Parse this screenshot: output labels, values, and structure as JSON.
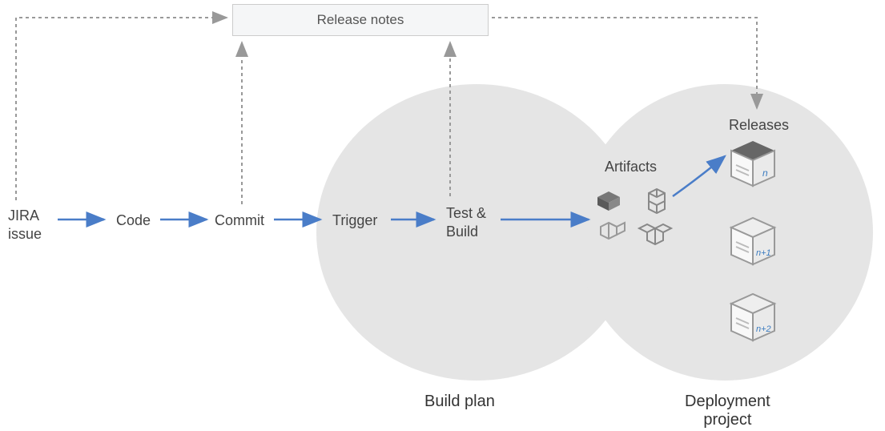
{
  "release_notes": "Release notes",
  "pipeline": {
    "jira": "JIRA\nissue",
    "code": "Code",
    "commit": "Commit",
    "trigger": "Trigger",
    "test_build": "Test &\nBuild",
    "artifacts": "Artifacts",
    "releases": "Releases"
  },
  "sections": {
    "build_plan": "Build plan",
    "deployment_project": "Deployment\nproject"
  },
  "release_boxes": [
    "n",
    "n+1",
    "n+2"
  ]
}
